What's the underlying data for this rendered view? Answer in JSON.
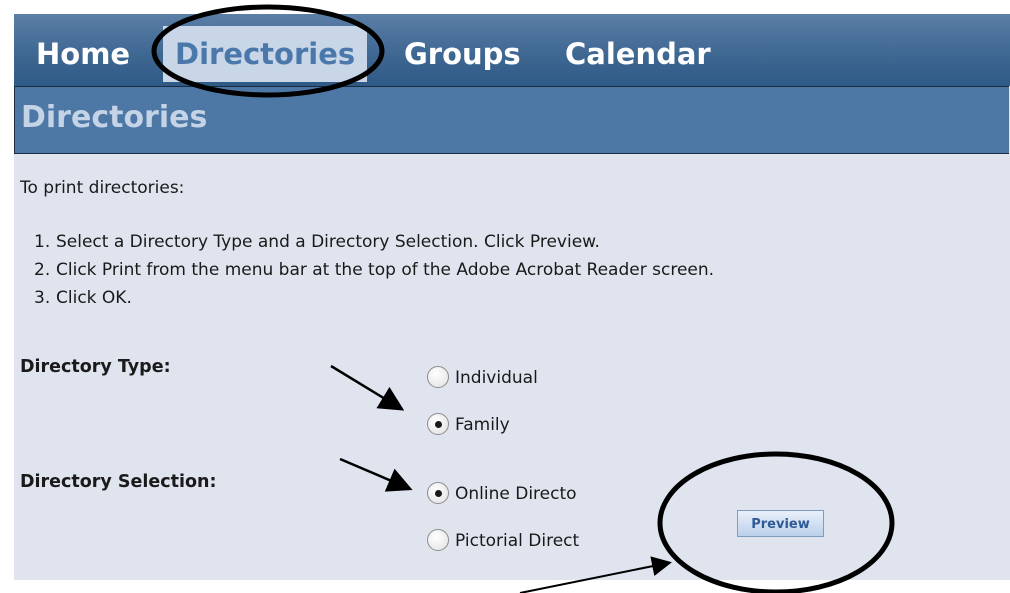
{
  "nav": {
    "tabs": [
      {
        "label": "Home",
        "active": false
      },
      {
        "label": "Directories",
        "active": true
      },
      {
        "label": "Groups",
        "active": false
      },
      {
        "label": "Calendar",
        "active": false
      }
    ]
  },
  "page": {
    "title": "Directories",
    "intro": "To print directories:",
    "steps": [
      {
        "num": "1.",
        "text": "Select a Directory Type and a Directory Selection. Click Preview."
      },
      {
        "num": "2.",
        "text": "Click Print from the menu bar at the top of the Adobe Acrobat Reader screen."
      },
      {
        "num": "3.",
        "text": "Click OK."
      }
    ]
  },
  "form": {
    "directory_type": {
      "label": "Directory Type:",
      "options": [
        {
          "label": "Individual",
          "checked": false
        },
        {
          "label": "Family",
          "checked": true
        }
      ]
    },
    "directory_selection": {
      "label": "Directory Selection:",
      "options": [
        {
          "label": "Online Directo",
          "checked": true
        },
        {
          "label": "Pictorial Direct",
          "checked": false
        }
      ]
    },
    "preview_label": "Preview"
  },
  "colors": {
    "nav_bg": "#3f6892",
    "title_bg": "#4d77a5",
    "content_bg": "#dfe4ee",
    "annotation": "#000000"
  }
}
